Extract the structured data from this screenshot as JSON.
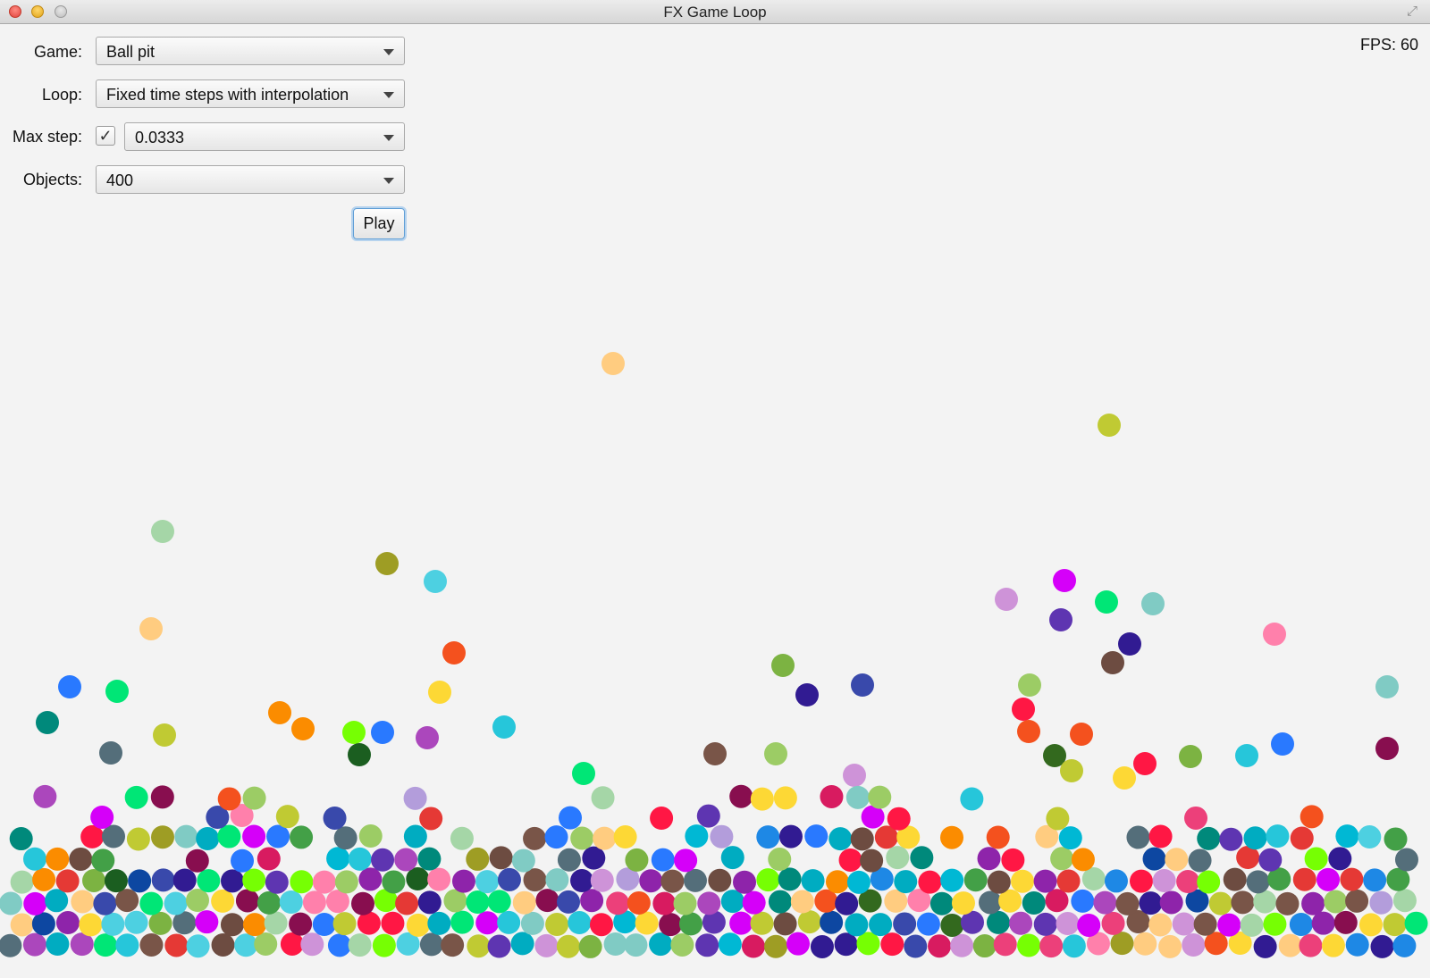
{
  "window": {
    "title": "FX Game Loop",
    "fullscreen_icon": "resize-arrows-icon"
  },
  "fps": {
    "text": "FPS: 60"
  },
  "controls": {
    "game": {
      "label": "Game:",
      "value": "Ball pit"
    },
    "loop": {
      "label": "Loop:",
      "value": "Fixed time steps with interpolation"
    },
    "max_step": {
      "label": "Max step:",
      "checked": true,
      "check_glyph": "✓",
      "value": "0.0333"
    },
    "objects": {
      "label": "Objects:",
      "value": "400"
    },
    "play_label": "Play"
  },
  "ball_pit": {
    "object_count": 400,
    "palette": [
      "#e53935",
      "#43a047",
      "#1e88e5",
      "#8e24aa",
      "#fdd835",
      "#00acc1",
      "#f4511e",
      "#6d4c41",
      "#3949ab",
      "#7cb342",
      "#d81b60",
      "#00897b",
      "#c0ca33",
      "#5e35b1",
      "#fb8c00",
      "#546e7a",
      "#ab47bc",
      "#26c6da",
      "#9ccc65",
      "#ec407a",
      "#1b5e20",
      "#880e4f",
      "#0d47a1",
      "#ff80ab",
      "#b39ddb",
      "#a5d6a7",
      "#ffcc80",
      "#4dd0e1",
      "#ce93d8",
      "#80cbc4",
      "#33691e",
      "#311b92",
      "#ff1744",
      "#00e676",
      "#2979ff",
      "#d500f9",
      "#76ff03",
      "#00b8d4",
      "#795548",
      "#9e9d24"
    ]
  }
}
